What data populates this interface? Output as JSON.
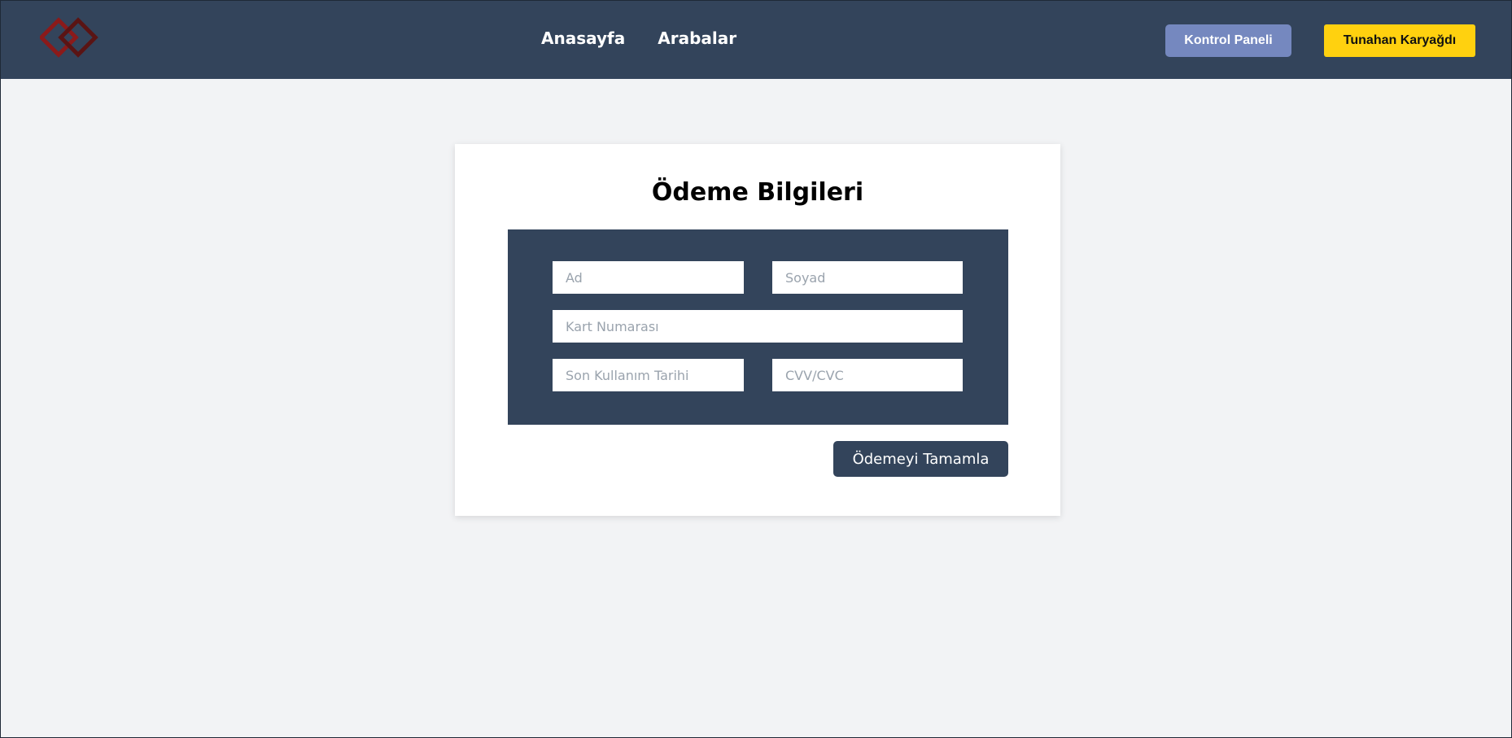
{
  "header": {
    "logo_icon": "interlocking-diamonds-logo",
    "nav": [
      "Anasayfa",
      "Arabalar"
    ],
    "control_panel_label": "Kontrol Paneli",
    "user_label": "Tunahan Karyağdı",
    "colors": {
      "navbar_bg": "#33445b",
      "panel_button": "#7588bf",
      "user_button": "#ffd10f",
      "logo": "#8b1a1a"
    }
  },
  "payment": {
    "title": "Ödeme Bilgileri",
    "fields": {
      "first_name_placeholder": "Ad",
      "last_name_placeholder": "Soyad",
      "card_number_placeholder": "Kart Numarası",
      "expiry_placeholder": "Son Kullanım Tarihi",
      "cvv_placeholder": "CVV/CVC"
    },
    "submit_label": "Ödemeyi Tamamla"
  }
}
